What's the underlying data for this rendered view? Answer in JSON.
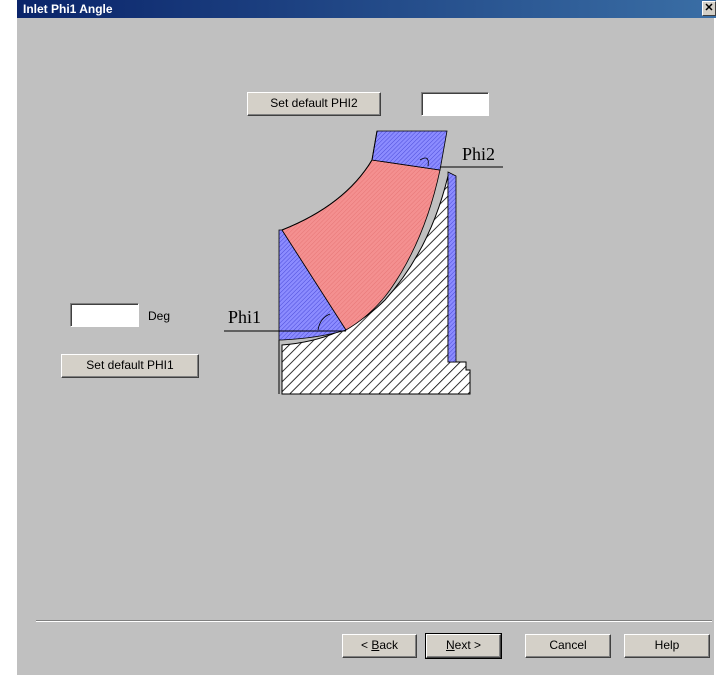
{
  "window": {
    "title": "Inlet Phi1 Angle",
    "close_glyph": "✕"
  },
  "phi2": {
    "button_label": "Set default PHI2",
    "value": "",
    "diagram_label": "Phi2"
  },
  "phi1": {
    "button_label": "Set default PHI1",
    "value": "",
    "unit": "Deg",
    "diagram_label": "Phi1"
  },
  "nav": {
    "back_prefix": "< ",
    "back_accel": "B",
    "back_rest": "ack",
    "next_accel": "N",
    "next_rest": "ext >",
    "cancel": "Cancel",
    "help": "Help"
  },
  "colors": {
    "blue_region": "#8080ff",
    "red_region": "#f08080",
    "hatch": "#000000"
  }
}
